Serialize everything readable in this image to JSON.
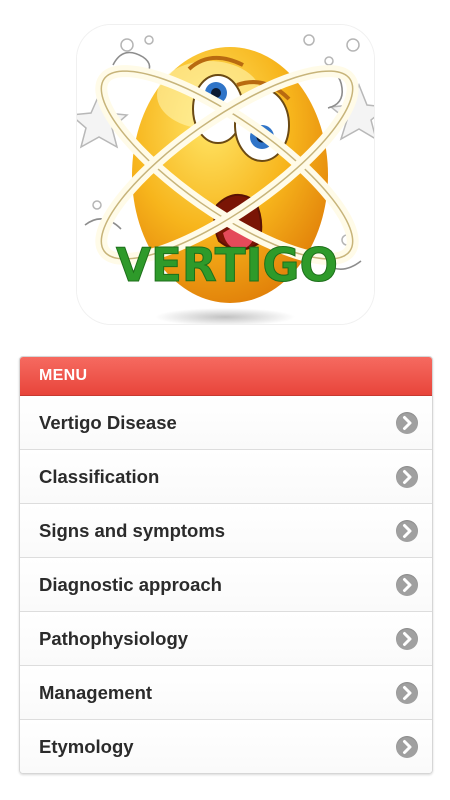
{
  "logo": {
    "text": "VERTIGO",
    "text_color": "#2e9a2a",
    "icon": "dizzy-emoji-icon"
  },
  "menu": {
    "header": "MENU",
    "header_color": "#ef5a50",
    "items": [
      {
        "label": "Vertigo Disease"
      },
      {
        "label": "Classification"
      },
      {
        "label": "Signs and symptoms"
      },
      {
        "label": "Diagnostic approach"
      },
      {
        "label": "Pathophysiology"
      },
      {
        "label": "Management"
      },
      {
        "label": "Etymology"
      }
    ],
    "item_icon": "chevron-right-icon"
  }
}
